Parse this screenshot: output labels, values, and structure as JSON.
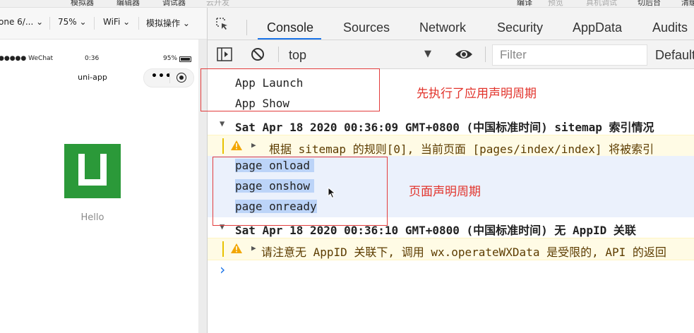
{
  "topbar": {
    "items": [
      "模拟器",
      "编辑器",
      "调试器",
      "云开发",
      "编译",
      "预览",
      "真机调试",
      "切后台",
      "清缓"
    ]
  },
  "simulator": {
    "device": "one 6/...",
    "zoom": "75%",
    "network": "WiFi",
    "operation": "模拟操作",
    "status_bar": {
      "carrier": "●●●●● WeChat",
      "time": "0:36",
      "battery": "95%"
    },
    "nav_title": "uni-app",
    "hello_text": "Hello",
    "logo_color": "#2b9939"
  },
  "devtools": {
    "tabs": [
      "Console",
      "Sources",
      "Network",
      "Security",
      "AppData",
      "Audits"
    ],
    "active_tab": "Console",
    "console_toolbar": {
      "context": "top",
      "filter_placeholder": "Filter",
      "levels": "Default"
    },
    "logs": {
      "app_launch": "App Launch",
      "app_show": "App Show",
      "group1_header": "Sat Apr 18 2020 00:36:09 GMT+0800 (中国标准时间) sitemap 索引情况",
      "group1_warning": "根据 sitemap 的规则[0], 当前页面 [pages/index/index] 将被索引",
      "page_onload": "page onload",
      "page_onshow": "page onshow",
      "page_onready": "page onready",
      "group2_header": "Sat Apr 18 2020 00:36:10 GMT+0800 (中国标准时间) 无 AppID 关联",
      "group2_warning": "请注意无 AppID 关联下, 调用 wx.operateWXData 是受限的, API 的返回",
      "prompt_symbol": "›"
    },
    "annotations": {
      "app_lifecycle": "先执行了应用声明周期",
      "page_lifecycle": "页面声明周期"
    }
  },
  "colors": {
    "accent": "#1a73e8",
    "annotation": "#e2342c",
    "warning_bg": "#fffbe5",
    "warning_icon": "#f2a600"
  }
}
